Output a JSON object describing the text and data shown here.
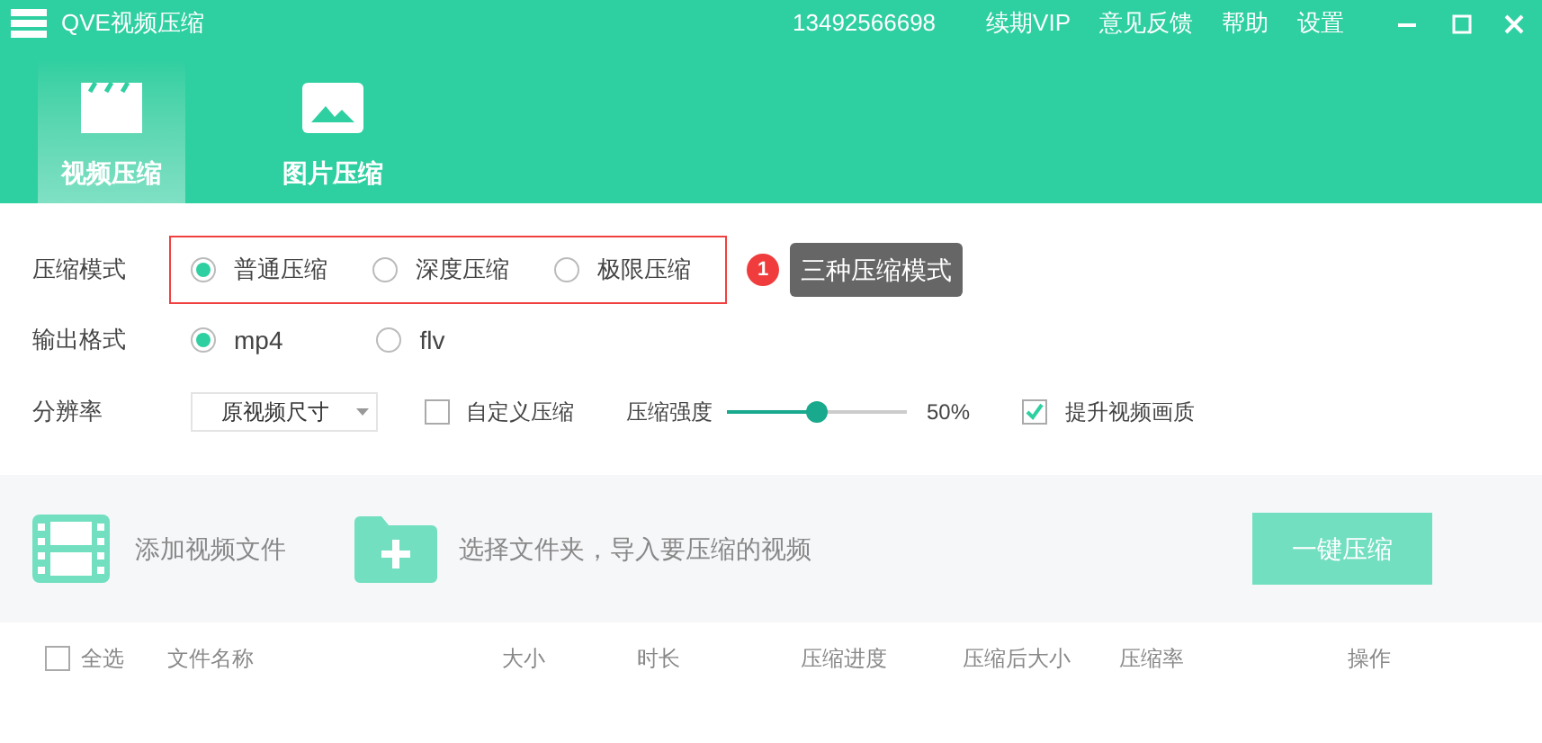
{
  "window": {
    "title": "QVE视频压缩",
    "account": "13492566698",
    "menu": [
      "续期VIP",
      "意见反馈",
      "帮助",
      "设置"
    ]
  },
  "tabs": [
    {
      "label": "视频压缩",
      "kind": "video",
      "selected": true
    },
    {
      "label": "图片压缩",
      "kind": "image",
      "selected": false
    }
  ],
  "settings": {
    "mode": {
      "label": "压缩模式",
      "options": [
        {
          "label": "普通压缩",
          "selected": true
        },
        {
          "label": "深度压缩",
          "selected": false
        },
        {
          "label": "极限压缩",
          "selected": false
        }
      ],
      "callout": {
        "number": "1",
        "text": "三种压缩模式"
      }
    },
    "format": {
      "label": "输出格式",
      "options": [
        {
          "label": "mp4",
          "selected": true
        },
        {
          "label": "flv",
          "selected": false
        }
      ]
    },
    "resolution": {
      "label": "分辨率",
      "value": "原视频尺寸"
    },
    "custom": {
      "label": "自定义压缩",
      "checked": false
    },
    "strength": {
      "label": "压缩强度",
      "level": 0.5,
      "reading": "50%"
    },
    "enhance": {
      "label": "提升视频画质",
      "checked": true
    }
  },
  "actions": {
    "add_file": "添加视频文件",
    "add_folder": "选择文件夹，导入要压缩的视频",
    "compress_all": "一键压缩"
  },
  "table": {
    "select_all": {
      "label": "全选",
      "checked": false
    },
    "columns": [
      "文件名称",
      "大小",
      "时长",
      "压缩进度",
      "压缩后大小",
      "压缩率",
      "操作"
    ]
  }
}
